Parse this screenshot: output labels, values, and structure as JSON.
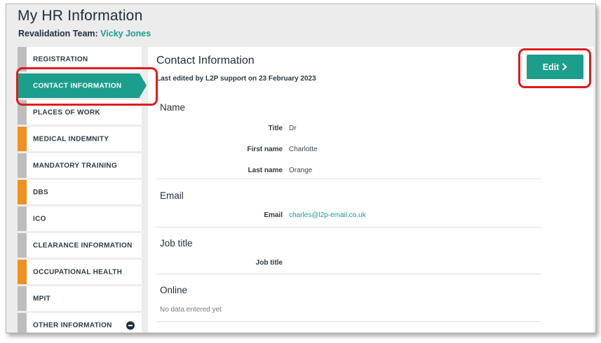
{
  "header": {
    "title": "My HR Information",
    "team_label": "Revalidation Team:",
    "team_name": "Vicky Jones"
  },
  "sidebar": {
    "items": [
      {
        "label": "REGISTRATION",
        "status": "grey"
      },
      {
        "label": "CONTACT INFORMATION",
        "status": "active"
      },
      {
        "label": "PLACES OF WORK",
        "status": "grey"
      },
      {
        "label": "MEDICAL INDEMNITY",
        "status": "orange"
      },
      {
        "label": "MANDATORY TRAINING",
        "status": "grey"
      },
      {
        "label": "DBS",
        "status": "orange"
      },
      {
        "label": "ICO",
        "status": "grey"
      },
      {
        "label": "CLEARANCE INFORMATION",
        "status": "grey"
      },
      {
        "label": "OCCUPATIONAL HEALTH",
        "status": "orange"
      },
      {
        "label": "MPIT",
        "status": "grey"
      },
      {
        "label": "OTHER INFORMATION",
        "status": "grey",
        "icon": "minus-circle-icon"
      }
    ]
  },
  "main": {
    "title": "Contact Information",
    "last_edited": "Last edited by L2P support on 23 February 2023",
    "edit_label": "Edit",
    "edit_icon": "chevron-right-icon",
    "name_section": {
      "heading": "Name",
      "fields": [
        {
          "label": "Title",
          "value": "Dr"
        },
        {
          "label": "First name",
          "value": "Charlotte"
        },
        {
          "label": "Last name",
          "value": "Orange"
        }
      ]
    },
    "email_section": {
      "heading": "Email",
      "fields": [
        {
          "label": "Email",
          "value": "charles@l2p-email.co.uk"
        }
      ]
    },
    "job_section": {
      "heading": "Job title",
      "fields": [
        {
          "label": "Job title",
          "value": ""
        }
      ]
    },
    "online_section": {
      "heading": "Online",
      "empty_text": "No data entered yet"
    }
  },
  "colors": {
    "accent": "#1b9e8c",
    "status_orange": "#f0911f",
    "status_grey": "#bdbdbd",
    "highlight": "#e01b1b"
  }
}
